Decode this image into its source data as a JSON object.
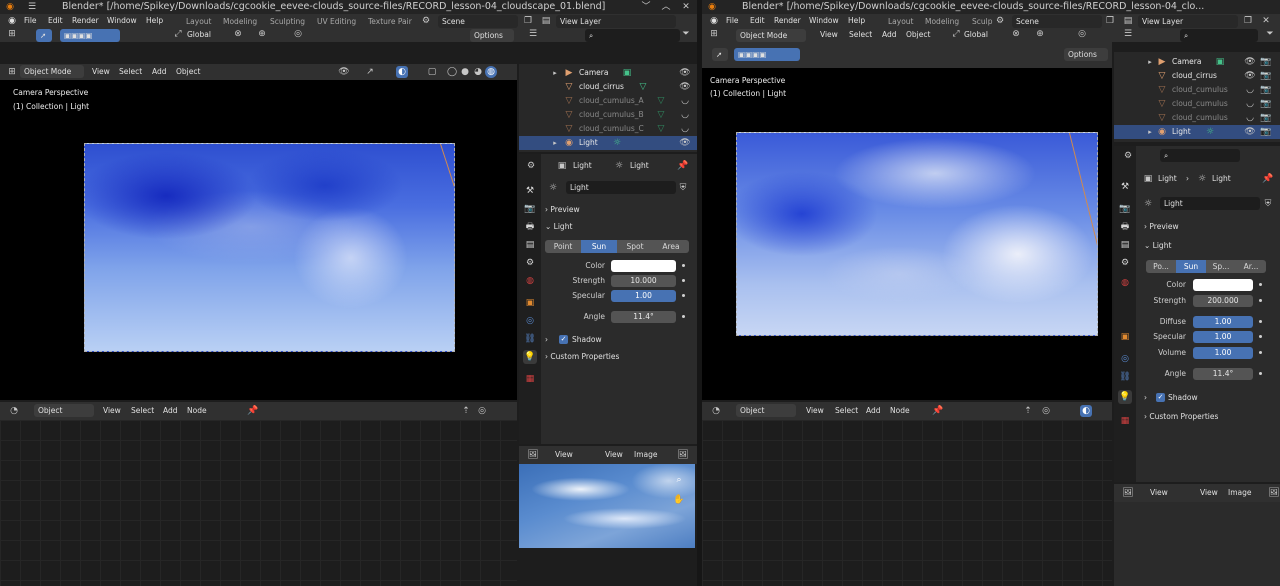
{
  "left_window": {
    "title": "Blender* [/home/Spikey/Downloads/cgcookie_eevee-clouds_source-files/RECORD_lesson-04_cloudscape_01.blend]",
    "menu": [
      "File",
      "Edit",
      "Render",
      "Window",
      "Help"
    ],
    "workspaces": [
      "Layout",
      "Modeling",
      "Sculpting",
      "UV Editing",
      "Texture Pair"
    ],
    "scene": "Scene",
    "view_layer": "View Layer",
    "transform_orientation": "Global",
    "options_label": "Options",
    "viewport_header": {
      "mode": "Object Mode",
      "menus": [
        "View",
        "Select",
        "Add",
        "Object"
      ]
    },
    "viewport_overlay_text": [
      "Camera Perspective",
      "(1) Collection | Light"
    ],
    "outliner": [
      {
        "name": "Camera",
        "dim": false,
        "selected": false,
        "icon": "camera-icon"
      },
      {
        "name": "cloud_cirrus",
        "dim": false,
        "selected": false,
        "icon": "mesh-icon"
      },
      {
        "name": "cloud_cumulus_A",
        "dim": true,
        "selected": false,
        "icon": "mesh-icon"
      },
      {
        "name": "cloud_cumulus_B",
        "dim": true,
        "selected": false,
        "icon": "mesh-icon"
      },
      {
        "name": "cloud_cumulus_C",
        "dim": true,
        "selected": false,
        "icon": "mesh-icon"
      },
      {
        "name": "Light",
        "dim": false,
        "selected": true,
        "icon": "light-icon"
      }
    ],
    "properties": {
      "breadcrumb_object": "Light",
      "breadcrumb_data": "Light",
      "datablock_name": "Light",
      "panel_preview": "Preview",
      "panel_light": "Light",
      "light_types": [
        "Point",
        "Sun",
        "Spot",
        "Area"
      ],
      "active_light_type": "Sun",
      "color_label": "Color",
      "strength_label": "Strength",
      "strength_value": "10.000",
      "specular_label": "Specular",
      "specular_value": "1.00",
      "angle_label": "Angle",
      "angle_value": "11.4°",
      "shadow_label": "Shadow",
      "custom_props_label": "Custom Properties"
    },
    "node_editor_header": {
      "type": "Object",
      "menus": [
        "View",
        "Select",
        "Add",
        "Node"
      ]
    },
    "image_editor_header": {
      "menus": [
        "View",
        "View",
        "Image"
      ]
    }
  },
  "right_window": {
    "title": "Blender* [/home/Spikey/Downloads/cgcookie_eevee-clouds_source-files/RECORD_lesson-04_clo...",
    "menu": [
      "File",
      "Edit",
      "Render",
      "Window",
      "Help"
    ],
    "workspaces": [
      "Layout",
      "Modeling",
      "Sculp"
    ],
    "scene": "Scene",
    "view_layer": "View Layer",
    "transform_orientation": "Global",
    "options_label": "Options",
    "viewport_header": {
      "mode": "Object Mode",
      "menus": [
        "View",
        "Select",
        "Add",
        "Object"
      ]
    },
    "viewport_overlay_text": [
      "Camera Perspective",
      "(1) Collection | Light"
    ],
    "outliner": [
      {
        "name": "Camera",
        "dim": false,
        "selected": false,
        "icon": "camera-icon"
      },
      {
        "name": "cloud_cirrus",
        "dim": false,
        "selected": false,
        "icon": "mesh-icon"
      },
      {
        "name": "cloud_cumulus",
        "dim": true,
        "selected": false,
        "icon": "mesh-icon"
      },
      {
        "name": "cloud_cumulus",
        "dim": true,
        "selected": false,
        "icon": "mesh-icon"
      },
      {
        "name": "cloud_cumulus",
        "dim": true,
        "selected": false,
        "icon": "mesh-icon"
      },
      {
        "name": "Light",
        "dim": false,
        "selected": true,
        "icon": "light-icon"
      }
    ],
    "properties": {
      "breadcrumb_object": "Light",
      "breadcrumb_data": "Light",
      "datablock_name": "Light",
      "panel_preview": "Preview",
      "panel_light": "Light",
      "light_types": [
        "Po...",
        "Sun",
        "Sp...",
        "Ar..."
      ],
      "active_light_type": "Sun",
      "color_label": "Color",
      "strength_label": "Strength",
      "strength_value": "200.000",
      "diffuse_label": "Diffuse",
      "diffuse_value": "1.00",
      "specular_label": "Specular",
      "specular_value": "1.00",
      "volume_label": "Volume",
      "volume_value": "1.00",
      "angle_label": "Angle",
      "angle_value": "11.4°",
      "shadow_label": "Shadow",
      "custom_props_label": "Custom Properties"
    },
    "node_editor_header": {
      "type": "Object",
      "menus": [
        "View",
        "Select",
        "Add",
        "Node"
      ]
    },
    "image_editor_header": {
      "menus": [
        "View",
        "View",
        "Image"
      ]
    }
  },
  "colors": {
    "accent_blue": "#4772b3",
    "selected_row": "#334d80",
    "light_icon": "#e0a070",
    "mesh_icon": "#45c28a"
  }
}
